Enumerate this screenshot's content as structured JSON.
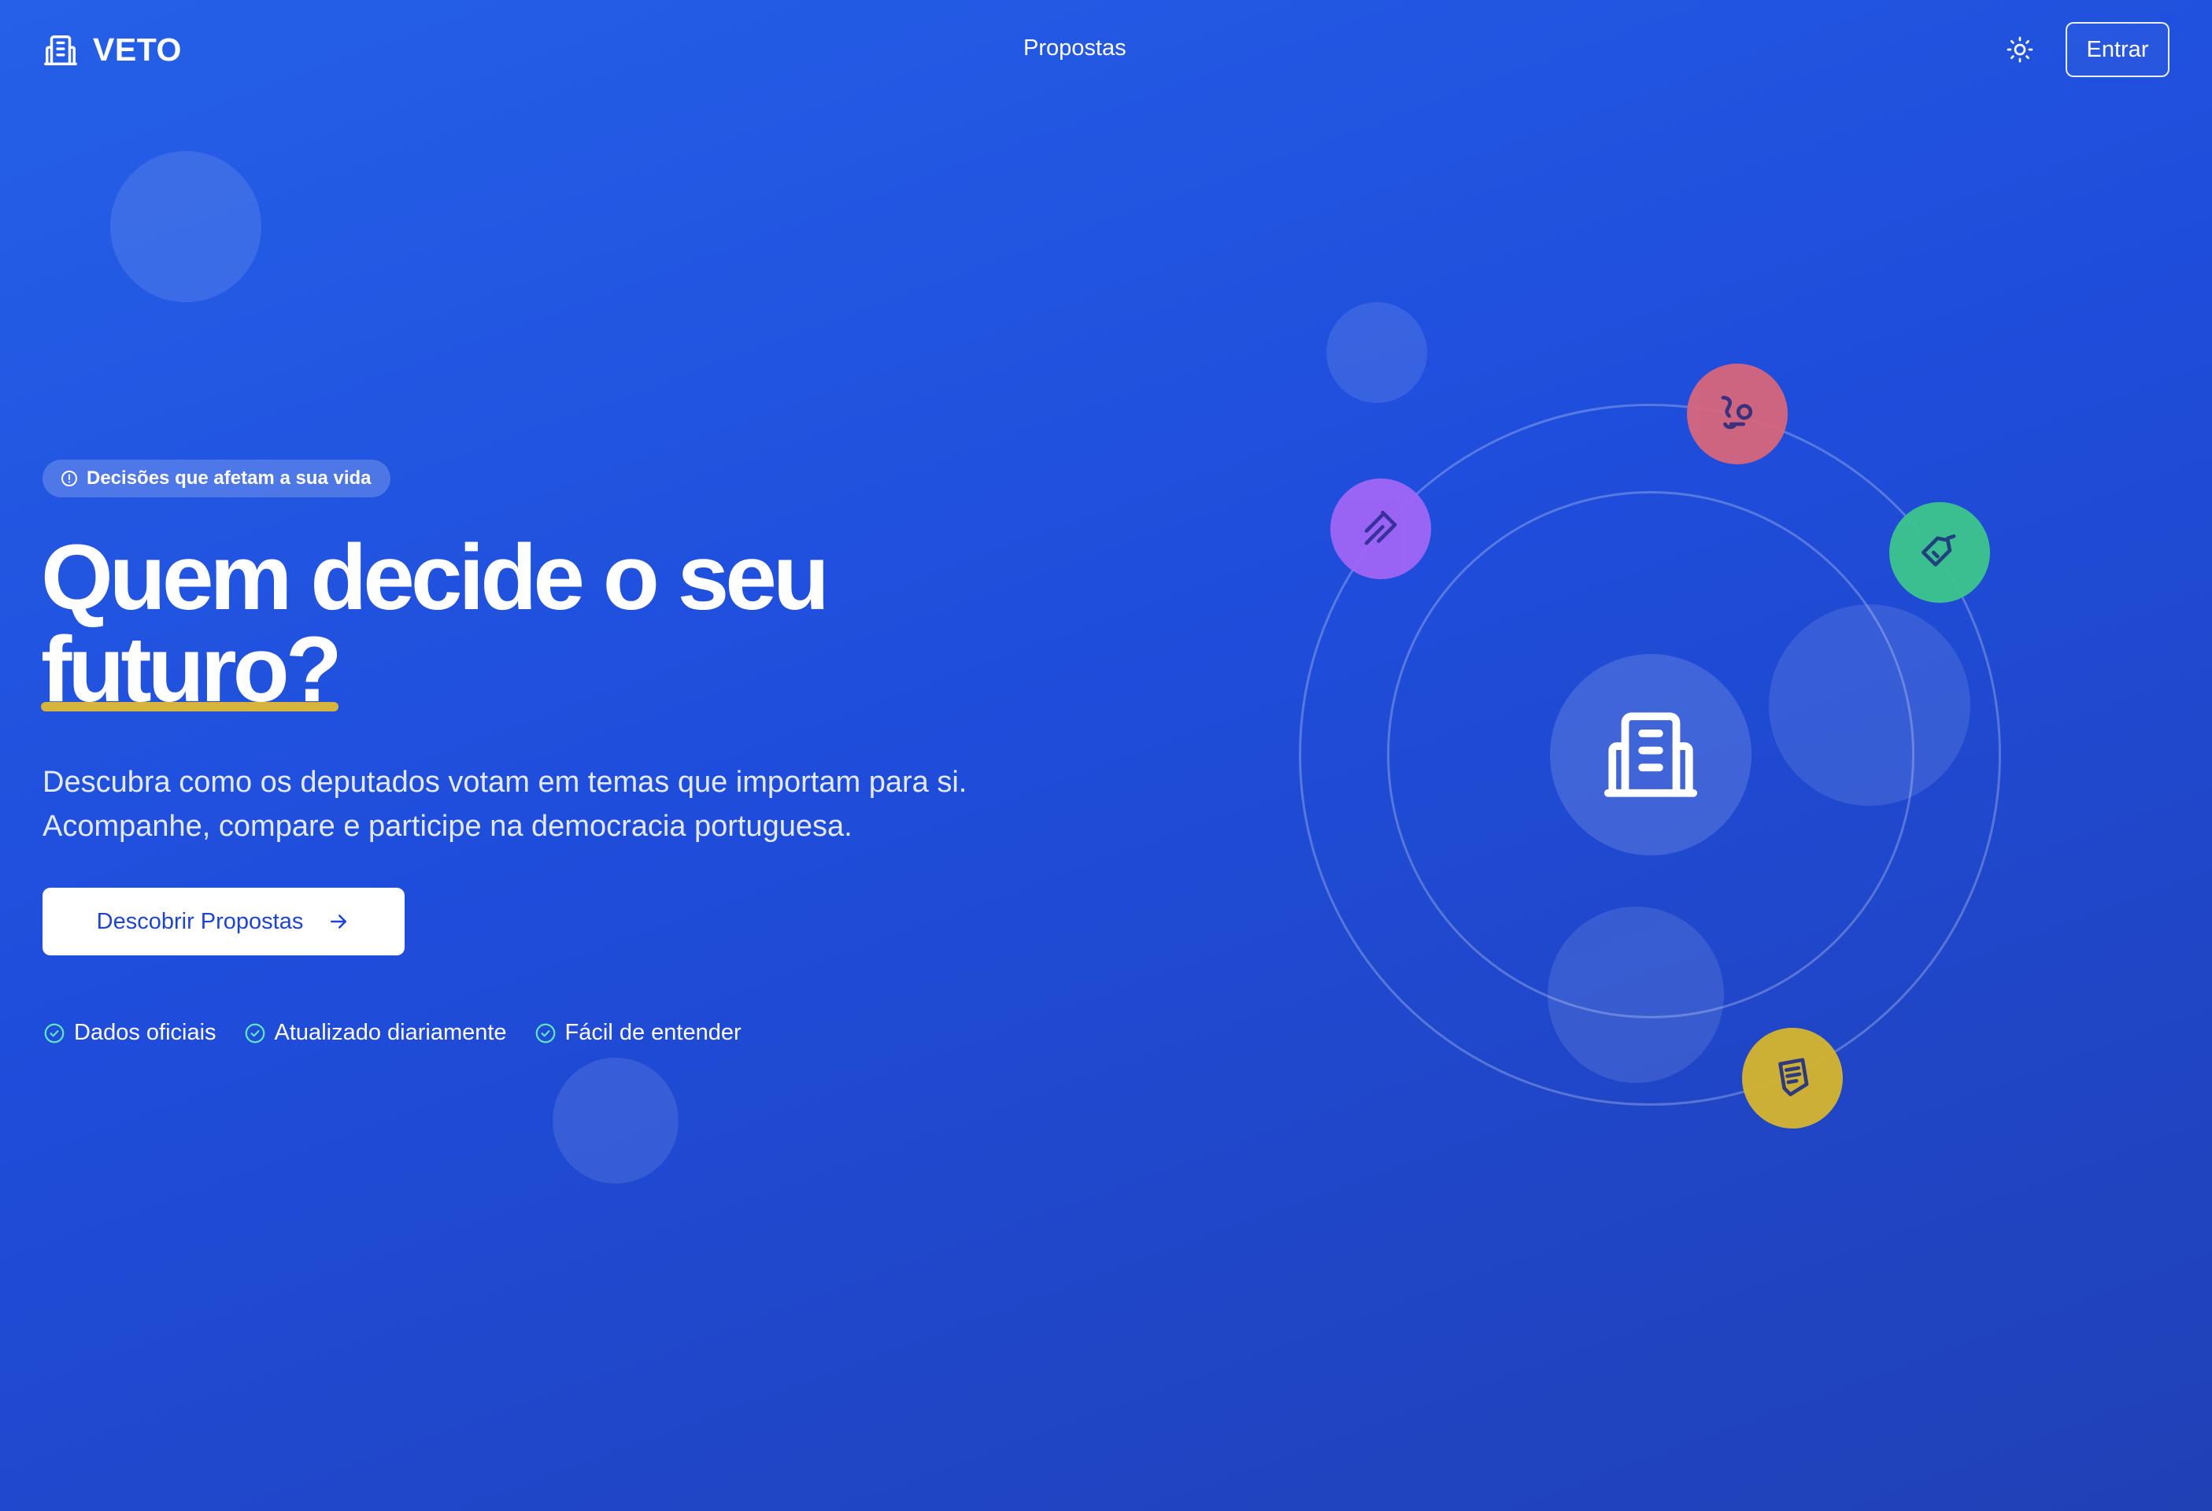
{
  "header": {
    "logo_text": "VETO",
    "nav": [
      {
        "label": "Propostas"
      }
    ],
    "login_label": "Entrar"
  },
  "hero": {
    "badge": "Decisões que afetam a sua vida",
    "title_line1": "Quem decide o seu",
    "title_highlight": "futuro?",
    "subtitle": "Descubra como os deputados votam em temas que importam para si. Acompanhe, compare e participe na democracia portuguesa.",
    "cta_label": "Descobrir Propostas",
    "features": [
      {
        "label": "Dados oficiais"
      },
      {
        "label": "Atualizado diariamente"
      },
      {
        "label": "Fácil de entender"
      }
    ]
  },
  "illustration": {
    "center_icon": "building-icon",
    "topics": [
      {
        "icon": "feather-icon",
        "color": "#a066f5"
      },
      {
        "icon": "scale-icon",
        "color": "#d8677c"
      },
      {
        "icon": "tag-icon",
        "color": "#3dc58d"
      },
      {
        "icon": "document-icon",
        "color": "#d6b52e"
      }
    ]
  },
  "colors": {
    "background_start": "#2560e8",
    "background_end": "#2040b6",
    "accent_underline": "#d7b43c",
    "cta_text": "#1d45d4"
  }
}
